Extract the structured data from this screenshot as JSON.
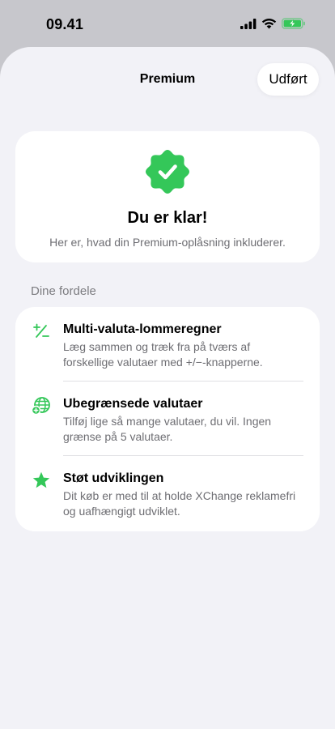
{
  "status_bar": {
    "time": "09.41",
    "icons": [
      "signal-icon",
      "wifi-icon",
      "battery-charging-icon"
    ]
  },
  "nav": {
    "title": "Premium",
    "done_label": "Udført"
  },
  "hero": {
    "badge_icon": "verified-check-badge-icon",
    "title": "Du er klar!",
    "subtitle": "Her er, hvad din Premium-oplåsning inkluderer."
  },
  "section": {
    "header": "Dine fordele"
  },
  "benefits": [
    {
      "icon": "plus-minus-icon",
      "title": "Multi-valuta-lommeregner",
      "description": "Læg sammen og træk fra på tværs af forskellige valutaer med +/−-knapperne."
    },
    {
      "icon": "globe-icon",
      "title": "Ubegrænsede valutaer",
      "description": "Tilføj lige så mange valutaer, du vil. Ingen grænse på 5 valutaer."
    },
    {
      "icon": "star-icon",
      "title": "Støt udviklingen",
      "description": "Dit køb er med til at holde XChange reklamefri og uafhængigt udviklet."
    }
  ],
  "colors": {
    "accent": "#34c759",
    "background": "#f2f2f7",
    "card": "#ffffff",
    "secondary_text": "#6e6e73"
  }
}
